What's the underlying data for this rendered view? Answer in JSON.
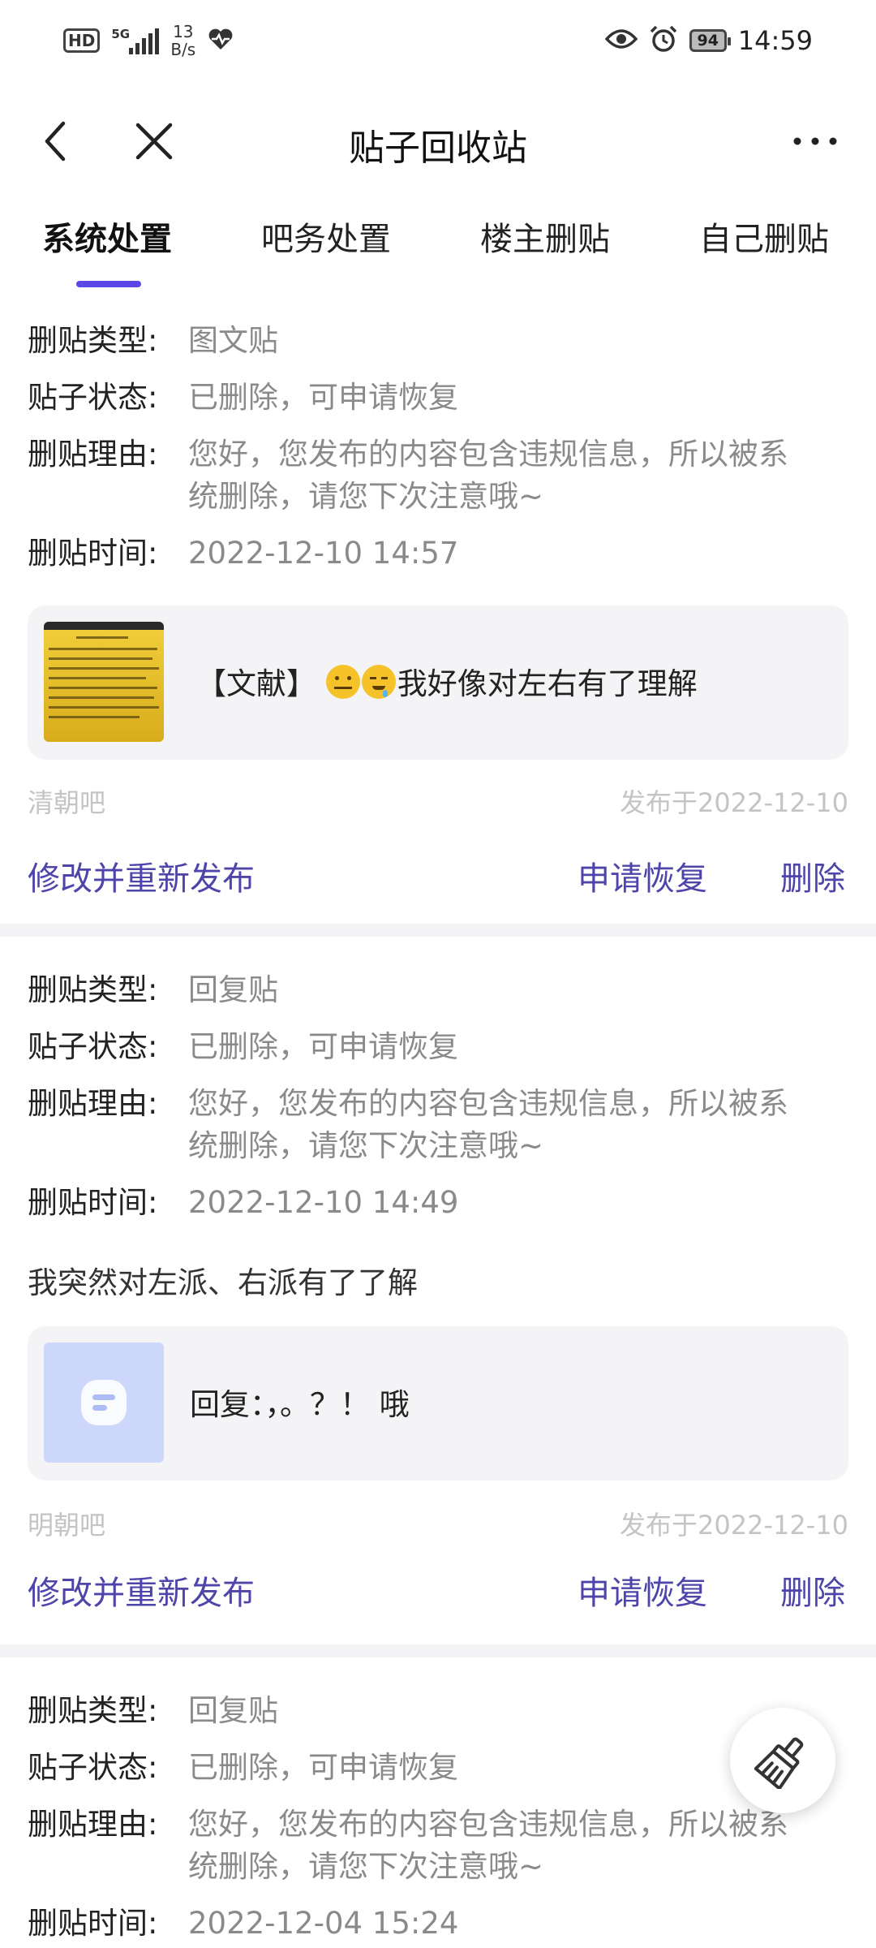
{
  "status_bar": {
    "hd": "HD",
    "network": "5G",
    "net_speed_value": "13",
    "net_speed_unit": "B/s",
    "battery": "94",
    "time": "14:59"
  },
  "header": {
    "title": "贴子回收站"
  },
  "tabs": [
    {
      "label": "系统处置",
      "active": true
    },
    {
      "label": "吧务处置",
      "active": false
    },
    {
      "label": "楼主删贴",
      "active": false
    },
    {
      "label": "自己删贴",
      "active": false
    }
  ],
  "labels": {
    "type": "删贴类型:",
    "status": "贴子状态:",
    "reason": "删贴理由:",
    "time": "删贴时间:"
  },
  "actions": {
    "edit_republish": "修改并重新发布",
    "restore": "申请恢复",
    "delete": "删除"
  },
  "posts": [
    {
      "type": "图文贴",
      "status": "已删除，可申请恢复",
      "reason_line1": "您好，您发布的内容包含违规信息，所以被系",
      "reason_line2": "统删除，请您下次注意哦~",
      "time": "2022-12-10 14:57",
      "title_prefix": "【文献】",
      "title_suffix": "我好像对左右有了理解",
      "forum": "清朝吧",
      "published": "发布于2022-12-10"
    },
    {
      "type": "回复贴",
      "status": "已删除，可申请恢复",
      "reason_line1": "您好，您发布的内容包含违规信息，所以被系",
      "reason_line2": "统删除，请您下次注意哦~",
      "time": "2022-12-10 14:49",
      "content": "我突然对左派、右派有了了解",
      "title": "回复：，。？！ 哦",
      "forum": "明朝吧",
      "published": "发布于2022-12-10"
    },
    {
      "type": "回复贴",
      "status": "已删除，可申请恢复",
      "reason_line1": "您好，您发布的内容包含违规信息，所以被系",
      "reason_line2": "统删除，请您下次注意哦~",
      "time": "2022-12-04 15:24"
    }
  ],
  "colors": {
    "accent": "#5a47e6",
    "action": "#4f44a9",
    "muted": "#8a8a8a",
    "meta": "#c4c4c4",
    "box": "#f4f4f6"
  },
  "icons": [
    "back-icon",
    "close-icon",
    "more-icon",
    "eye-icon",
    "alarm-icon",
    "heart-pulse-icon",
    "broom-icon"
  ]
}
